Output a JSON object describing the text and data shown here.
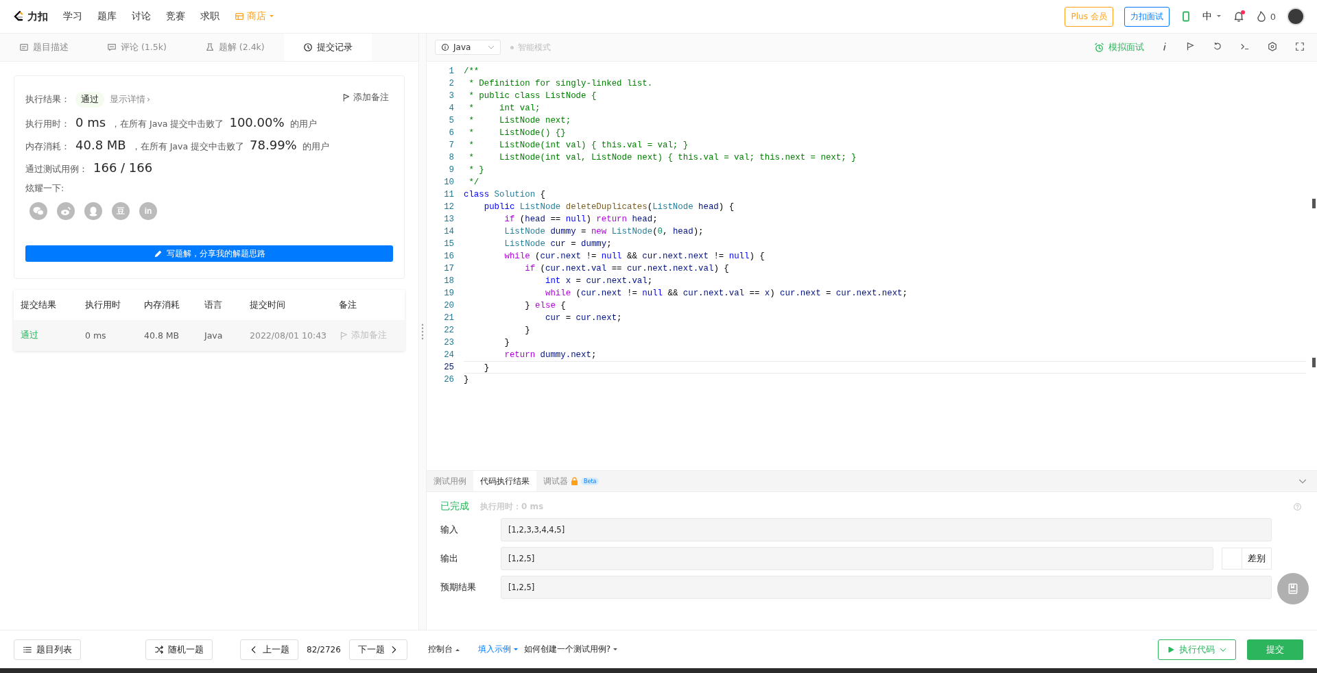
{
  "nav": {
    "logo": "力扣",
    "items": [
      {
        "label": "学习",
        "kind": "plain"
      },
      {
        "label": "题库",
        "kind": "plain"
      },
      {
        "label": "讨论",
        "kind": "plain"
      },
      {
        "label": "竞赛",
        "kind": "plain"
      },
      {
        "label": "求职",
        "kind": "plain"
      },
      {
        "label": "商店",
        "kind": "shop"
      }
    ],
    "plus": "Plus 会员",
    "interview": "力扣面试",
    "lang": "中",
    "unread": true,
    "fire_count": "0"
  },
  "tabs": [
    {
      "label": "题目描述",
      "selected": false,
      "kind": "doc"
    },
    {
      "label": "评论 (1.5k)",
      "selected": false,
      "kind": "comment"
    },
    {
      "label": "题解 (2.4k)",
      "selected": false,
      "kind": "flask"
    },
    {
      "label": "提交记录",
      "selected": true,
      "kind": "clock"
    }
  ],
  "editor_toolbar": {
    "language": "Java",
    "mode": "智能模式",
    "mock": "模拟面试"
  },
  "result": {
    "status_label": "执行结果：",
    "status": "通过",
    "details": "显示详情",
    "details_arrow": "›",
    "note": "添加备注",
    "runtime_label": "执行用时：",
    "runtime": "0 ms",
    "runtime_text": "，在所有 Java 提交中击败了",
    "runtime_pct": "100.00%",
    "runtime_users": "的用户",
    "memory_label": "内存消耗：",
    "memory": "40.8 MB",
    "memory_text": "，在所有 Java 提交中击败了",
    "memory_pct": "78.99%",
    "memory_users": "的用户",
    "tests_label": "通过测试用例：",
    "tests": "166 / 166",
    "share_label": "炫耀一下:",
    "share": [
      {
        "kind": "wechat"
      },
      {
        "kind": "weibo"
      },
      {
        "kind": "qq"
      },
      {
        "kind": "text",
        "label": "豆"
      },
      {
        "kind": "text",
        "label": "in"
      }
    ],
    "write_button": "写题解，分享我的解题思路"
  },
  "submissions": {
    "columns": [
      "提交结果",
      "执行用时",
      "内存消耗",
      "语言",
      "提交时间",
      "备注"
    ],
    "rows": [
      {
        "status": "通过",
        "runtime": "0 ms",
        "memory": "40.8 MB",
        "language": "Java",
        "time": "2022/08/01 10:43",
        "note": "添加备注"
      }
    ]
  },
  "code": {
    "lines": [
      {
        "n": "1",
        "current": false,
        "tokens": [
          {
            "text": "/**",
            "kind": "comment"
          }
        ]
      },
      {
        "n": "2",
        "current": false,
        "tokens": [
          {
            "text": " * Definition for singly-linked list.",
            "kind": "comment"
          }
        ]
      },
      {
        "n": "3",
        "current": false,
        "tokens": [
          {
            "text": " * public class ListNode {",
            "kind": "comment"
          }
        ]
      },
      {
        "n": "4",
        "current": false,
        "tokens": [
          {
            "text": " *     int val;",
            "kind": "comment"
          }
        ]
      },
      {
        "n": "5",
        "current": false,
        "tokens": [
          {
            "text": " *     ListNode next;",
            "kind": "comment"
          }
        ]
      },
      {
        "n": "6",
        "current": false,
        "tokens": [
          {
            "text": " *     ListNode() {}",
            "kind": "comment"
          }
        ]
      },
      {
        "n": "7",
        "current": false,
        "tokens": [
          {
            "text": " *     ListNode(int val) { this.val = val; }",
            "kind": "comment"
          }
        ]
      },
      {
        "n": "8",
        "current": false,
        "tokens": [
          {
            "text": " *     ListNode(int val, ListNode next) { this.val = val; this.next = next; }",
            "kind": "comment"
          }
        ]
      },
      {
        "n": "9",
        "current": false,
        "tokens": [
          {
            "text": " * }",
            "kind": "comment"
          }
        ]
      },
      {
        "n": "10",
        "current": false,
        "tokens": [
          {
            "text": " */",
            "kind": "comment"
          }
        ]
      },
      {
        "n": "11",
        "current": false,
        "tokens": [
          {
            "text": "class",
            "kind": "keyword"
          },
          {
            "text": " Solution",
            "kind": "type"
          },
          {
            "text": " {",
            "kind": "plain"
          }
        ]
      },
      {
        "n": "12",
        "current": false,
        "tokens": [
          {
            "text": "    public",
            "kind": "keyword"
          },
          {
            "text": " ListNode",
            "kind": "type"
          },
          {
            "text": " deleteDuplicates",
            "kind": "function"
          },
          {
            "text": "(",
            "kind": "plain"
          },
          {
            "text": "ListNode",
            "kind": "type"
          },
          {
            "text": " head",
            "kind": "variable"
          },
          {
            "text": ") {",
            "kind": "plain"
          }
        ]
      },
      {
        "n": "13",
        "current": false,
        "tokens": [
          {
            "text": "        if",
            "kind": "control"
          },
          {
            "text": " (",
            "kind": "plain"
          },
          {
            "text": "head",
            "kind": "variable"
          },
          {
            "text": " ==",
            "kind": "plain"
          },
          {
            "text": " null",
            "kind": "keyword"
          },
          {
            "text": ")",
            "kind": "plain"
          },
          {
            "text": " return",
            "kind": "control"
          },
          {
            "text": " head",
            "kind": "variable"
          },
          {
            "text": ";",
            "kind": "plain"
          }
        ]
      },
      {
        "n": "14",
        "current": false,
        "tokens": [
          {
            "text": "        ListNode",
            "kind": "type"
          },
          {
            "text": " dummy",
            "kind": "variable"
          },
          {
            "text": " =",
            "kind": "plain"
          },
          {
            "text": " new",
            "kind": "control"
          },
          {
            "text": " ListNode",
            "kind": "type"
          },
          {
            "text": "(",
            "kind": "plain"
          },
          {
            "text": "0",
            "kind": "number"
          },
          {
            "text": ",",
            "kind": "plain"
          },
          {
            "text": " head",
            "kind": "variable"
          },
          {
            "text": ");",
            "kind": "plain"
          }
        ]
      },
      {
        "n": "15",
        "current": false,
        "tokens": [
          {
            "text": "        ListNode",
            "kind": "type"
          },
          {
            "text": " cur",
            "kind": "variable"
          },
          {
            "text": " =",
            "kind": "plain"
          },
          {
            "text": " dummy",
            "kind": "variable"
          },
          {
            "text": ";",
            "kind": "plain"
          }
        ]
      },
      {
        "n": "16",
        "current": false,
        "tokens": [
          {
            "text": "        while",
            "kind": "control"
          },
          {
            "text": " (",
            "kind": "plain"
          },
          {
            "text": "cur.next",
            "kind": "variable"
          },
          {
            "text": " !=",
            "kind": "plain"
          },
          {
            "text": " null",
            "kind": "keyword"
          },
          {
            "text": " &&",
            "kind": "plain"
          },
          {
            "text": " cur.next.next",
            "kind": "variable"
          },
          {
            "text": " !=",
            "kind": "plain"
          },
          {
            "text": " null",
            "kind": "keyword"
          },
          {
            "text": ") {",
            "kind": "plain"
          }
        ]
      },
      {
        "n": "17",
        "current": false,
        "tokens": [
          {
            "text": "            if",
            "kind": "control"
          },
          {
            "text": " (",
            "kind": "plain"
          },
          {
            "text": "cur.next.val",
            "kind": "variable"
          },
          {
            "text": " ==",
            "kind": "plain"
          },
          {
            "text": " cur.next.next.val",
            "kind": "variable"
          },
          {
            "text": ") {",
            "kind": "plain"
          }
        ]
      },
      {
        "n": "18",
        "current": false,
        "tokens": [
          {
            "text": "                int",
            "kind": "keyword"
          },
          {
            "text": " x",
            "kind": "variable"
          },
          {
            "text": " =",
            "kind": "plain"
          },
          {
            "text": " cur.next.val",
            "kind": "variable"
          },
          {
            "text": ";",
            "kind": "plain"
          }
        ]
      },
      {
        "n": "19",
        "current": false,
        "tokens": [
          {
            "text": "                while",
            "kind": "control"
          },
          {
            "text": " (",
            "kind": "plain"
          },
          {
            "text": "cur.next",
            "kind": "variable"
          },
          {
            "text": " !=",
            "kind": "plain"
          },
          {
            "text": " null",
            "kind": "keyword"
          },
          {
            "text": " &&",
            "kind": "plain"
          },
          {
            "text": " cur.next.val",
            "kind": "variable"
          },
          {
            "text": " ==",
            "kind": "plain"
          },
          {
            "text": " x",
            "kind": "variable"
          },
          {
            "text": ")",
            "kind": "plain"
          },
          {
            "text": " cur.next",
            "kind": "variable"
          },
          {
            "text": " =",
            "kind": "plain"
          },
          {
            "text": " cur.next.next",
            "kind": "variable"
          },
          {
            "text": ";",
            "kind": "plain"
          }
        ]
      },
      {
        "n": "20",
        "current": false,
        "tokens": [
          {
            "text": "            }",
            "kind": "plain"
          },
          {
            "text": " else",
            "kind": "control"
          },
          {
            "text": " {",
            "kind": "plain"
          }
        ]
      },
      {
        "n": "21",
        "current": false,
        "tokens": [
          {
            "text": "                cur",
            "kind": "variable"
          },
          {
            "text": " =",
            "kind": "plain"
          },
          {
            "text": " cur.next",
            "kind": "variable"
          },
          {
            "text": ";",
            "kind": "plain"
          }
        ]
      },
      {
        "n": "22",
        "current": false,
        "tokens": [
          {
            "text": "            }",
            "kind": "plain"
          }
        ]
      },
      {
        "n": "23",
        "current": false,
        "tokens": [
          {
            "text": "        }",
            "kind": "plain"
          }
        ]
      },
      {
        "n": "24",
        "current": false,
        "tokens": [
          {
            "text": "        return",
            "kind": "control"
          },
          {
            "text": " dummy.next",
            "kind": "variable"
          },
          {
            "text": ";",
            "kind": "plain"
          }
        ]
      },
      {
        "n": "25",
        "current": true,
        "tokens": [
          {
            "text": "    }",
            "kind": "plain"
          }
        ]
      },
      {
        "n": "26",
        "current": false,
        "tokens": [
          {
            "text": "}",
            "kind": "plain"
          }
        ]
      }
    ]
  },
  "console": {
    "tabs": [
      {
        "label": "测试用例",
        "selected": false
      },
      {
        "label": "代码执行结果",
        "selected": true
      },
      {
        "label": "调试器",
        "selected": false,
        "locked": true,
        "badge": "Beta"
      }
    ],
    "status": "已完成",
    "runtime": "执行用时：0 ms",
    "rows": [
      {
        "label": "输入",
        "value": "[1,2,3,3,4,4,5]"
      },
      {
        "label": "输出",
        "value": "[1,2,5]",
        "diff": "差别",
        "diff_on": false
      },
      {
        "label": "预期结果",
        "value": "[1,2,5]"
      }
    ]
  },
  "footer": {
    "list": "题目列表",
    "random": "随机一题",
    "prev": "上一题",
    "position": "82/2726",
    "next": "下一题",
    "console": "控制台",
    "fill": "填入示例",
    "howto": "如何创建一个测试用例?",
    "run": "执行代码",
    "submit": "提交"
  }
}
